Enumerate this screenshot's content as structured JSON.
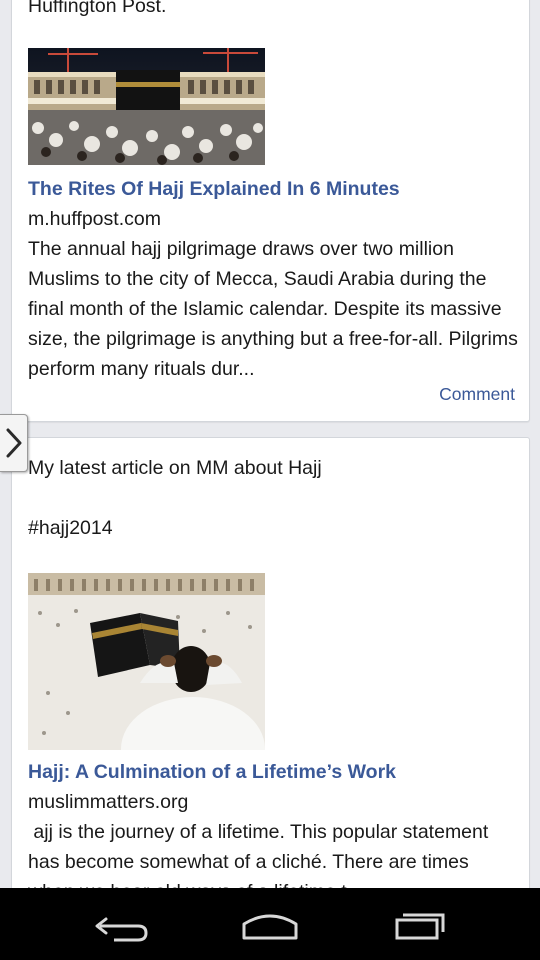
{
  "posts": [
    {
      "intro_tail": "Huffington Post.",
      "link_title": "The Rites Of Hajj Explained In 6 Minutes",
      "link_domain": "m.huffpost.com",
      "link_description": "The annual hajj pilgrimage draws over two million Muslims to the city of Mecca, Saudi Arabia during the final month of the Islamic calendar. Despite its massive size, the pilgrimage is anything but a free-for-all. Pilgrims perform many rituals dur...",
      "comment_label": "Comment"
    },
    {
      "message": "My latest article on MM about Hajj",
      "hashtag": "#hajj2014",
      "link_title": "Hajj: A Culmination of a Lifetime’s Work",
      "link_domain": "muslimmatters.org",
      "link_description": " ajj is the journey of a lifetime. This popular statement has become somewhat of a cliché. There are times when we hear old ways of a lifetime t"
    }
  ],
  "icons": {
    "side_tab": "chevron-right-icon",
    "back": "back-icon",
    "home": "home-icon",
    "recents": "recent-apps-icon"
  },
  "colors": {
    "link": "#3b5998",
    "background": "#e9eaee",
    "navbar": "#000000"
  }
}
